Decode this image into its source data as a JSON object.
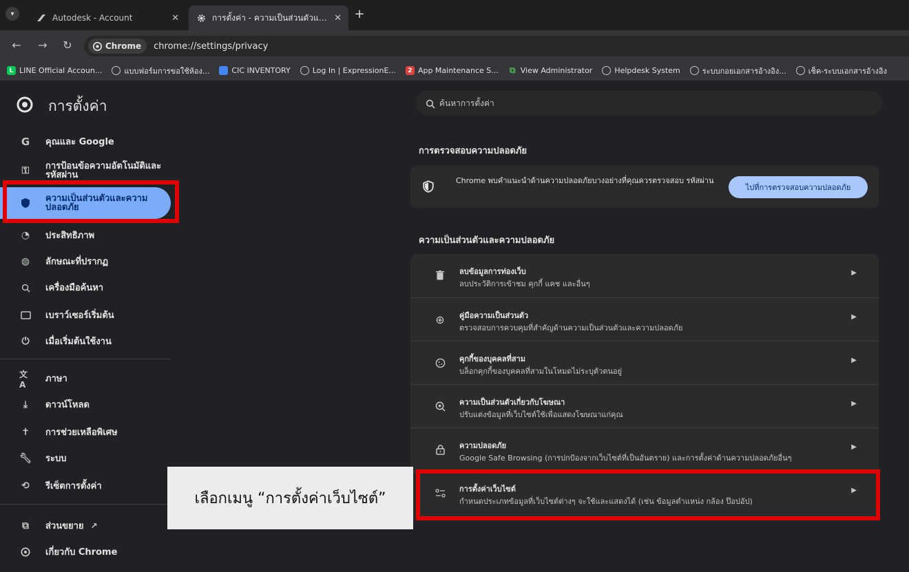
{
  "tabs": [
    {
      "title": "Autodesk - Account",
      "icon": "autodesk-icon",
      "active": false
    },
    {
      "title": "การตั้งค่า - ความเป็นส่วนตัวและความ",
      "icon": "gear-icon",
      "active": true
    }
  ],
  "toolbar": {
    "chip_label": "Chrome",
    "url": "chrome://settings/privacy"
  },
  "bookmarks": [
    {
      "label": "LINE Official Accoun...",
      "icon": "line-icon",
      "color": "#06c755"
    },
    {
      "label": "แบบฟอร์มการขอใช้ห้อง...",
      "icon": "globe-icon",
      "color": "#c4c7c5"
    },
    {
      "label": "CIC INVENTORY",
      "icon": "doc-icon",
      "color": "#4285f4"
    },
    {
      "label": "Log In | ExpressionE...",
      "icon": "globe-icon",
      "color": "#c4c7c5"
    },
    {
      "label": "App Maintenance S...",
      "icon": "app-icon",
      "color": "#e04040"
    },
    {
      "label": "View Administrator",
      "icon": "admin-icon",
      "color": "#4caf50"
    },
    {
      "label": "Helpdesk System",
      "icon": "globe-icon",
      "color": "#c4c7c5"
    },
    {
      "label": "ระบบกอยเอกสารอ้างอิง...",
      "icon": "globe-icon",
      "color": "#c4c7c5"
    },
    {
      "label": "เช็ค-ระบบเอกสารอ้างอิง",
      "icon": "globe-icon",
      "color": "#c4c7c5"
    }
  ],
  "settings": {
    "title": "การตั้งค่า",
    "search_placeholder": "ค้นหาการตั้งค่า"
  },
  "sidebar": {
    "items": [
      {
        "label": "คุณและ Google",
        "icon": "google-g-icon"
      },
      {
        "label": "การป้อนข้อความอัตโนมัติและรหัสผ่าน",
        "icon": "key-icon"
      },
      {
        "label": "ความเป็นส่วนตัวและความปลอดภัย",
        "icon": "shield-icon",
        "selected": true
      },
      {
        "label": "ประสิทธิภาพ",
        "icon": "speedometer-icon"
      },
      {
        "label": "ลักษณะที่ปรากฏ",
        "icon": "palette-icon"
      },
      {
        "label": "เครื่องมือค้นหา",
        "icon": "search-icon"
      },
      {
        "label": "เบราว์เซอร์เริ่มต้น",
        "icon": "browser-icon"
      },
      {
        "label": "เมื่อเริ่มต้นใช้งาน",
        "icon": "power-icon"
      },
      {
        "label": "ภาษา",
        "icon": "translate-icon"
      },
      {
        "label": "ดาวน์โหลด",
        "icon": "download-icon"
      },
      {
        "label": "การช่วยเหลือพิเศษ",
        "icon": "accessibility-icon"
      },
      {
        "label": "ระบบ",
        "icon": "wrench-icon"
      },
      {
        "label": "รีเซ็ตการตั้งค่า",
        "icon": "reset-icon"
      },
      {
        "label": "ส่วนขยาย",
        "icon": "extension-icon"
      },
      {
        "label": "เกี่ยวกับ Chrome",
        "icon": "chrome-icon"
      }
    ]
  },
  "safety_check": {
    "section_title": "การตรวจสอบความปลอดภัย",
    "message": "Chrome พบคำแนะนำด้านความปลอดภัยบางอย่างที่คุณควรตรวจสอบ รหัสผ่าน",
    "button_label": "ไปที่การตรวจสอบความปลอดภัย"
  },
  "privacy": {
    "section_title": "ความเป็นส่วนตัวและความปลอดภัย",
    "rows": [
      {
        "title": "ลบข้อมูลการท่องเว็บ",
        "subtitle": "ลบประวัติการเข้าชม คุกกี้ แคช และอื่นๆ",
        "icon": "trash-icon"
      },
      {
        "title": "คู่มือความเป็นส่วนตัว",
        "subtitle": "ตรวจสอบการควบคุมที่สำคัญด้านความเป็นส่วนตัวและความปลอดภัย",
        "icon": "privacy-guide-icon"
      },
      {
        "title": "คุกกี้ของบุคคลที่สาม",
        "subtitle": "บล็อกคุกกี้ของบุคคลที่สามในโหมดไม่ระบุตัวตนอยู่",
        "icon": "cookie-icon"
      },
      {
        "title": "ความเป็นส่วนตัวเกี่ยวกับโฆษณา",
        "subtitle": "ปรับแต่งข้อมูลที่เว็บไซต์ใช้เพื่อแสดงโฆษณาแก่คุณ",
        "icon": "ad-privacy-icon"
      },
      {
        "title": "ความปลอดภัย",
        "subtitle": "Google Safe Browsing (การปกป้องจากเว็บไซต์ที่เป็นอันตราย) และการตั้งค่าด้านความปลอดภัยอื่นๆ",
        "icon": "lock-icon"
      },
      {
        "title": "การตั้งค่าเว็บไซต์",
        "subtitle": "กำหนดประเภทข้อมูลที่เว็บไซต์ต่างๆ จะใช้และแสดงได้ (เช่น ข้อมูลตำแหน่ง กล้อง ป๊อปอัป)",
        "icon": "tune-icon"
      }
    ]
  },
  "annotation": {
    "text": "เลือกเมนู “การตั้งค่าเว็บไซต์”",
    "highlight_color": "#e00000"
  },
  "colors": {
    "accent": "#7cacf8",
    "button": "#a8c7fa",
    "background": "#202124"
  }
}
